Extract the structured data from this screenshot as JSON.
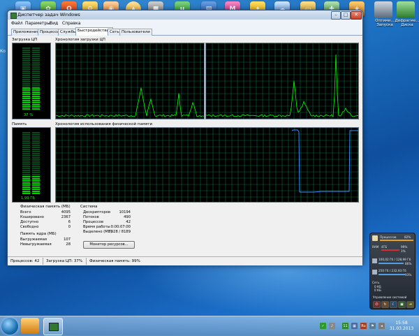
{
  "window": {
    "title": "Диспетчер задач Windows",
    "controls": [
      "–",
      "□",
      "✕"
    ]
  },
  "menu": [
    "Файл",
    "Параметры",
    "Вид",
    "Справка"
  ],
  "tabs": [
    "Приложения",
    "Процессы",
    "Службы",
    "Быстродействие",
    "Сеть",
    "Пользователи"
  ],
  "active_tab": "Быстродействие",
  "cpu": {
    "usage_label": "Загрузка ЦП",
    "usage_value": "37 %",
    "usage_percent": 37,
    "history_label": "Хронология загрузки ЦП"
  },
  "memory": {
    "usage_label": "Память",
    "usage_value": "1,99 ГБ",
    "usage_fraction": 0.3,
    "history_label": "Хронология использования физической памяти"
  },
  "physical_memory": {
    "title": "Физическая память (МБ)",
    "rows": [
      {
        "label": "Всего",
        "value": "4095"
      },
      {
        "label": "Кэшировано",
        "value": "2367"
      },
      {
        "label": "Доступно",
        "value": "6"
      },
      {
        "label": "Свободно",
        "value": "0"
      }
    ]
  },
  "kernel_memory": {
    "title": "Память ядра (МБ)",
    "rows": [
      {
        "label": "Выгружаемая",
        "value": "107"
      },
      {
        "label": "Невыгружаемая",
        "value": "28"
      }
    ]
  },
  "system": {
    "title": "Система",
    "rows": [
      {
        "label": "Дескрипторов",
        "value": "10194"
      },
      {
        "label": "Потоков",
        "value": "490"
      },
      {
        "label": "Процессов",
        "value": "42"
      },
      {
        "label": "Время работы",
        "value": "0:00:07:00"
      },
      {
        "label": "Выделено (МБ)",
        "value": "7928 / 8189"
      }
    ]
  },
  "resource_monitor_button": "Монитор ресурсов...",
  "statusbar": {
    "processes": "Процессов: 42",
    "cpu": "Загрузка ЦП: 37%",
    "memory": "Физическая память: 99%"
  },
  "desktop": {
    "icon_optimize": "Оптими...\nЗапуска",
    "icon_defrag": "Дефрагме...\nДиска",
    "left_fragment": "Ко"
  },
  "gadget": {
    "processes_label": "Процессов",
    "processes_value": "82%",
    "ram_label": "RAM",
    "ram_total": "4ГБ",
    "ram_used": "99%",
    "ram_free": "1%",
    "disk1_left": "100,02 Гб / 128,99 Гб",
    "disk1_pct": "86%",
    "disk2_left": "250 Гб / 232,93 Гб",
    "disk2_pct": "93%",
    "net_label": "Сеть",
    "net_up": "0 КБ",
    "net_down": "0 КБ",
    "footer": "Управление системой"
  },
  "clock": {
    "time": "15:58",
    "date": "31.03.2013"
  },
  "colors": {
    "graph_green": "#00ff00",
    "grid": "#0a6b3a",
    "memory_line": "#3c8cff"
  }
}
